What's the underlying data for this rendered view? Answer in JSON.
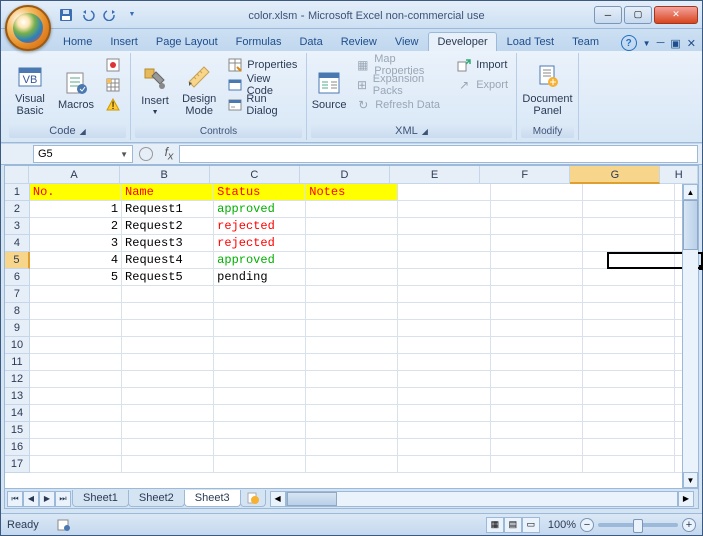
{
  "window": {
    "filename": "color.xlsm",
    "app": "Microsoft Excel non-commercial use"
  },
  "ribbon": {
    "tabs": [
      "Home",
      "Insert",
      "Page Layout",
      "Formulas",
      "Data",
      "Review",
      "View",
      "Developer",
      "Load Test",
      "Team"
    ],
    "active_tab": "Developer",
    "groups": {
      "code": {
        "label": "Code",
        "visual_basic": "Visual Basic",
        "macros": "Macros",
        "record": "Record Macro",
        "relative": "Use Relative References",
        "security": "Macro Security"
      },
      "controls": {
        "label": "Controls",
        "insert": "Insert",
        "design": "Design Mode",
        "properties": "Properties",
        "view_code": "View Code",
        "run_dialog": "Run Dialog"
      },
      "xml": {
        "label": "XML",
        "source": "Source",
        "map_props": "Map Properties",
        "expansion": "Expansion Packs",
        "refresh": "Refresh Data",
        "import": "Import",
        "export": "Export"
      },
      "modify": {
        "label": "Modify",
        "doc_panel": "Document Panel"
      }
    }
  },
  "namebox": "G5",
  "formula": "",
  "columns": [
    "A",
    "B",
    "C",
    "D",
    "E",
    "F",
    "G",
    "H"
  ],
  "active_col": "G",
  "active_row": 5,
  "data": {
    "headers": [
      "No.",
      "Name",
      "Status",
      "Notes"
    ],
    "rows": [
      {
        "no": 1,
        "name": "Request1",
        "status": "approved",
        "status_class": "approved"
      },
      {
        "no": 2,
        "name": "Request2",
        "status": "rejected",
        "status_class": "rejected"
      },
      {
        "no": 3,
        "name": "Request3",
        "status": "rejected",
        "status_class": "rejected"
      },
      {
        "no": 4,
        "name": "Request4",
        "status": "approved",
        "status_class": "approved"
      },
      {
        "no": 5,
        "name": "Request5",
        "status": "pending",
        "status_class": ""
      }
    ]
  },
  "sheets": [
    "Sheet1",
    "Sheet2",
    "Sheet3"
  ],
  "active_sheet": "Sheet3",
  "status": {
    "ready": "Ready",
    "zoom": "100%"
  }
}
